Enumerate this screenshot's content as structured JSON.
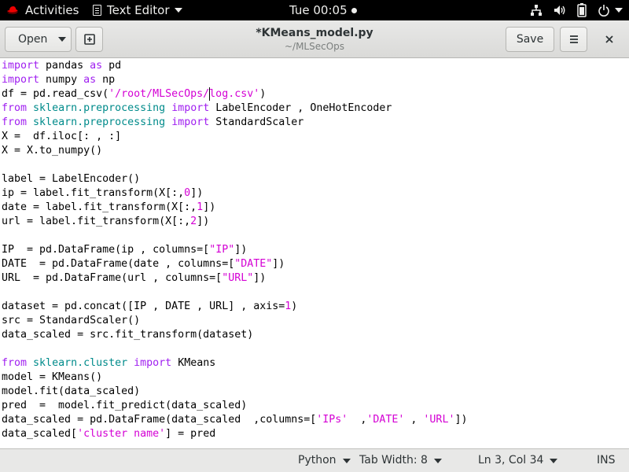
{
  "topbar": {
    "activities": "Activities",
    "app_menu": "Text Editor",
    "clock": "Tue 00:05",
    "icons": [
      "network-icon",
      "volume-icon",
      "battery-icon",
      "power-icon"
    ]
  },
  "headerbar": {
    "open_label": "Open",
    "title": "*KMeans_model.py",
    "path": "~/MLSecOps",
    "save_label": "Save"
  },
  "colors": {
    "keyword": "#a020f0",
    "string": "#d400d4",
    "module": "#008b8b",
    "text": "#000000"
  },
  "editor": {
    "lines": [
      [
        [
          "k",
          "import"
        ],
        [
          "p",
          " pandas "
        ],
        [
          "k",
          "as"
        ],
        [
          "p",
          " pd"
        ]
      ],
      [
        [
          "k",
          "import"
        ],
        [
          "p",
          " numpy "
        ],
        [
          "k",
          "as"
        ],
        [
          "p",
          " np"
        ]
      ],
      [
        [
          "p",
          "df = pd.read_csv("
        ],
        [
          "s",
          "'/root/MLSecOps/log.csv'"
        ],
        [
          "p",
          ")"
        ]
      ],
      [
        [
          "k",
          "from"
        ],
        [
          "p",
          " "
        ],
        [
          "m",
          "sklearn.preprocessing"
        ],
        [
          "p",
          " "
        ],
        [
          "k",
          "import"
        ],
        [
          "p",
          " LabelEncoder , OneHotEncoder"
        ]
      ],
      [
        [
          "k",
          "from"
        ],
        [
          "p",
          " "
        ],
        [
          "m",
          "sklearn.preprocessing"
        ],
        [
          "p",
          " "
        ],
        [
          "k",
          "import"
        ],
        [
          "p",
          " StandardScaler"
        ]
      ],
      [
        [
          "p",
          "X =  df.iloc[: , :]"
        ]
      ],
      [
        [
          "p",
          "X = X.to_numpy()"
        ]
      ],
      [],
      [
        [
          "p",
          "label = LabelEncoder()"
        ]
      ],
      [
        [
          "p",
          "ip = label.fit_transform(X[:,"
        ],
        [
          "n",
          "0"
        ],
        [
          "p",
          "])"
        ]
      ],
      [
        [
          "p",
          "date = label.fit_transform(X[:,"
        ],
        [
          "n",
          "1"
        ],
        [
          "p",
          "])"
        ]
      ],
      [
        [
          "p",
          "url = label.fit_transform(X[:,"
        ],
        [
          "n",
          "2"
        ],
        [
          "p",
          "])"
        ]
      ],
      [],
      [
        [
          "p",
          "IP  = pd.DataFrame(ip , columns=["
        ],
        [
          "s",
          "\"IP\""
        ],
        [
          "p",
          "])"
        ]
      ],
      [
        [
          "p",
          "DATE  = pd.DataFrame(date , columns=["
        ],
        [
          "s",
          "\"DATE\""
        ],
        [
          "p",
          "])"
        ]
      ],
      [
        [
          "p",
          "URL  = pd.DataFrame(url , columns=["
        ],
        [
          "s",
          "\"URL\""
        ],
        [
          "p",
          "])"
        ]
      ],
      [],
      [
        [
          "p",
          "dataset = pd.concat([IP , DATE , URL] , axis="
        ],
        [
          "n",
          "1"
        ],
        [
          "p",
          ")"
        ]
      ],
      [
        [
          "p",
          "src = StandardScaler()"
        ]
      ],
      [
        [
          "p",
          "data_scaled = src.fit_transform(dataset)"
        ]
      ],
      [],
      [
        [
          "k",
          "from"
        ],
        [
          "p",
          " "
        ],
        [
          "m",
          "sklearn.cluster"
        ],
        [
          "p",
          " "
        ],
        [
          "k",
          "import"
        ],
        [
          "p",
          " KMeans"
        ]
      ],
      [
        [
          "p",
          "model = KMeans()"
        ]
      ],
      [
        [
          "p",
          "model.fit(data_scaled)"
        ]
      ],
      [
        [
          "p",
          "pred  =  model.fit_predict(data_scaled)"
        ]
      ],
      [
        [
          "p",
          "data_scaled = pd.DataFrame(data_scaled  ,columns=["
        ],
        [
          "s",
          "'IPs'"
        ],
        [
          "p",
          "  ,"
        ],
        [
          "s",
          "'DATE'"
        ],
        [
          "p",
          " , "
        ],
        [
          "s",
          "'URL'"
        ],
        [
          "p",
          "])"
        ]
      ],
      [
        [
          "p",
          "data_scaled["
        ],
        [
          "s",
          "'cluster name'"
        ],
        [
          "p",
          "] = pred"
        ]
      ]
    ]
  },
  "statusbar": {
    "language": "Python",
    "tab_width": "Tab Width: 8",
    "position": "Ln 3, Col 34",
    "mode": "INS"
  }
}
